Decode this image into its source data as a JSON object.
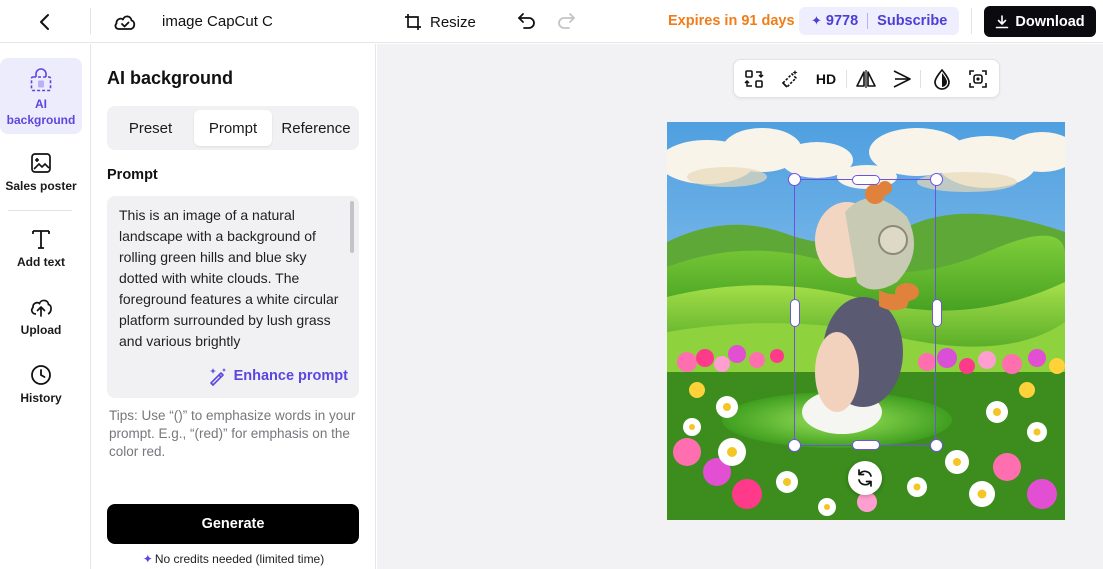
{
  "topbar": {
    "project_title": "image CapCut C",
    "resize_label": "Resize",
    "expires_label": "Expires in 91 days",
    "credits": "9778",
    "subscribe_label": "Subscribe",
    "download_label": "Download",
    "accent_color": "#f07d1a",
    "brand_color": "#5b46e0"
  },
  "rail": {
    "items": [
      {
        "label": "AI background",
        "icon": "lock-icon",
        "active": true
      },
      {
        "label": "Sales poster",
        "icon": "poster-icon"
      },
      {
        "label": "Add text",
        "icon": "text-icon"
      },
      {
        "label": "Upload",
        "icon": "upload-icon"
      },
      {
        "label": "History",
        "icon": "history-icon"
      }
    ]
  },
  "panel": {
    "title": "AI background",
    "tabs": [
      {
        "label": "Preset"
      },
      {
        "label": "Prompt",
        "active": true
      },
      {
        "label": "Reference"
      }
    ],
    "prompt_heading": "Prompt",
    "prompt_text": "This is an image of a natural landscape with a background of rolling green hills and blue sky dotted with white clouds. The foreground features a white circular platform surrounded by lush grass and various brightly",
    "enhance_label": "Enhance prompt",
    "tips": "Tips: Use “()” to emphasize words in your prompt. E.g., “(red)” for emphasis on the color red.",
    "generate_label": "Generate",
    "no_credits_label": "No credits needed (limited time)"
  },
  "canvas": {
    "toolbar": {
      "items": [
        "replace-icon",
        "erase-icon",
        "HD",
        "flip-icon",
        "arrange-icon",
        "opacity-icon",
        "focus-icon"
      ],
      "hd_label": "HD"
    },
    "image": {
      "description_icon": "landscape-image"
    }
  }
}
